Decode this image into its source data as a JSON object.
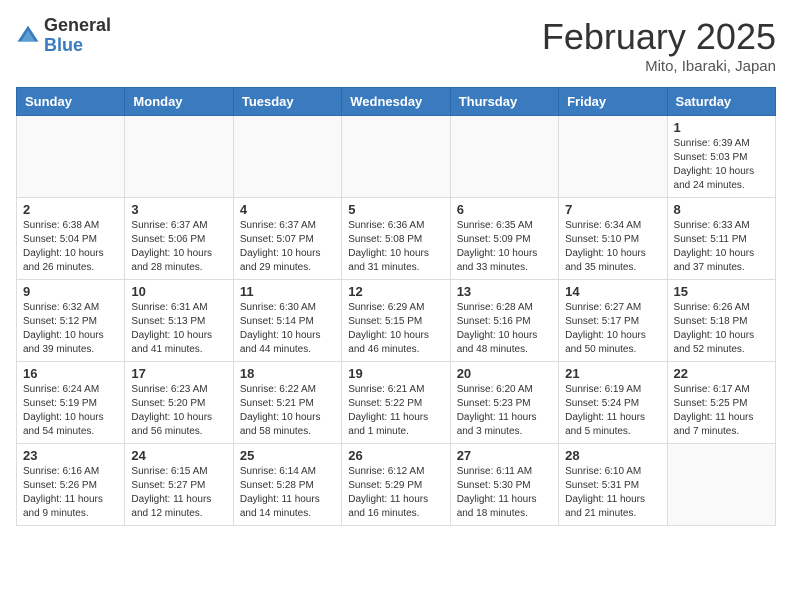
{
  "header": {
    "logo_general": "General",
    "logo_blue": "Blue",
    "month_title": "February 2025",
    "location": "Mito, Ibaraki, Japan"
  },
  "weekdays": [
    "Sunday",
    "Monday",
    "Tuesday",
    "Wednesday",
    "Thursday",
    "Friday",
    "Saturday"
  ],
  "weeks": [
    [
      {
        "day": "",
        "info": ""
      },
      {
        "day": "",
        "info": ""
      },
      {
        "day": "",
        "info": ""
      },
      {
        "day": "",
        "info": ""
      },
      {
        "day": "",
        "info": ""
      },
      {
        "day": "",
        "info": ""
      },
      {
        "day": "1",
        "info": "Sunrise: 6:39 AM\nSunset: 5:03 PM\nDaylight: 10 hours and 24 minutes."
      }
    ],
    [
      {
        "day": "2",
        "info": "Sunrise: 6:38 AM\nSunset: 5:04 PM\nDaylight: 10 hours and 26 minutes."
      },
      {
        "day": "3",
        "info": "Sunrise: 6:37 AM\nSunset: 5:06 PM\nDaylight: 10 hours and 28 minutes."
      },
      {
        "day": "4",
        "info": "Sunrise: 6:37 AM\nSunset: 5:07 PM\nDaylight: 10 hours and 29 minutes."
      },
      {
        "day": "5",
        "info": "Sunrise: 6:36 AM\nSunset: 5:08 PM\nDaylight: 10 hours and 31 minutes."
      },
      {
        "day": "6",
        "info": "Sunrise: 6:35 AM\nSunset: 5:09 PM\nDaylight: 10 hours and 33 minutes."
      },
      {
        "day": "7",
        "info": "Sunrise: 6:34 AM\nSunset: 5:10 PM\nDaylight: 10 hours and 35 minutes."
      },
      {
        "day": "8",
        "info": "Sunrise: 6:33 AM\nSunset: 5:11 PM\nDaylight: 10 hours and 37 minutes."
      }
    ],
    [
      {
        "day": "9",
        "info": "Sunrise: 6:32 AM\nSunset: 5:12 PM\nDaylight: 10 hours and 39 minutes."
      },
      {
        "day": "10",
        "info": "Sunrise: 6:31 AM\nSunset: 5:13 PM\nDaylight: 10 hours and 41 minutes."
      },
      {
        "day": "11",
        "info": "Sunrise: 6:30 AM\nSunset: 5:14 PM\nDaylight: 10 hours and 44 minutes."
      },
      {
        "day": "12",
        "info": "Sunrise: 6:29 AM\nSunset: 5:15 PM\nDaylight: 10 hours and 46 minutes."
      },
      {
        "day": "13",
        "info": "Sunrise: 6:28 AM\nSunset: 5:16 PM\nDaylight: 10 hours and 48 minutes."
      },
      {
        "day": "14",
        "info": "Sunrise: 6:27 AM\nSunset: 5:17 PM\nDaylight: 10 hours and 50 minutes."
      },
      {
        "day": "15",
        "info": "Sunrise: 6:26 AM\nSunset: 5:18 PM\nDaylight: 10 hours and 52 minutes."
      }
    ],
    [
      {
        "day": "16",
        "info": "Sunrise: 6:24 AM\nSunset: 5:19 PM\nDaylight: 10 hours and 54 minutes."
      },
      {
        "day": "17",
        "info": "Sunrise: 6:23 AM\nSunset: 5:20 PM\nDaylight: 10 hours and 56 minutes."
      },
      {
        "day": "18",
        "info": "Sunrise: 6:22 AM\nSunset: 5:21 PM\nDaylight: 10 hours and 58 minutes."
      },
      {
        "day": "19",
        "info": "Sunrise: 6:21 AM\nSunset: 5:22 PM\nDaylight: 11 hours and 1 minute."
      },
      {
        "day": "20",
        "info": "Sunrise: 6:20 AM\nSunset: 5:23 PM\nDaylight: 11 hours and 3 minutes."
      },
      {
        "day": "21",
        "info": "Sunrise: 6:19 AM\nSunset: 5:24 PM\nDaylight: 11 hours and 5 minutes."
      },
      {
        "day": "22",
        "info": "Sunrise: 6:17 AM\nSunset: 5:25 PM\nDaylight: 11 hours and 7 minutes."
      }
    ],
    [
      {
        "day": "23",
        "info": "Sunrise: 6:16 AM\nSunset: 5:26 PM\nDaylight: 11 hours and 9 minutes."
      },
      {
        "day": "24",
        "info": "Sunrise: 6:15 AM\nSunset: 5:27 PM\nDaylight: 11 hours and 12 minutes."
      },
      {
        "day": "25",
        "info": "Sunrise: 6:14 AM\nSunset: 5:28 PM\nDaylight: 11 hours and 14 minutes."
      },
      {
        "day": "26",
        "info": "Sunrise: 6:12 AM\nSunset: 5:29 PM\nDaylight: 11 hours and 16 minutes."
      },
      {
        "day": "27",
        "info": "Sunrise: 6:11 AM\nSunset: 5:30 PM\nDaylight: 11 hours and 18 minutes."
      },
      {
        "day": "28",
        "info": "Sunrise: 6:10 AM\nSunset: 5:31 PM\nDaylight: 11 hours and 21 minutes."
      },
      {
        "day": "",
        "info": ""
      }
    ]
  ]
}
